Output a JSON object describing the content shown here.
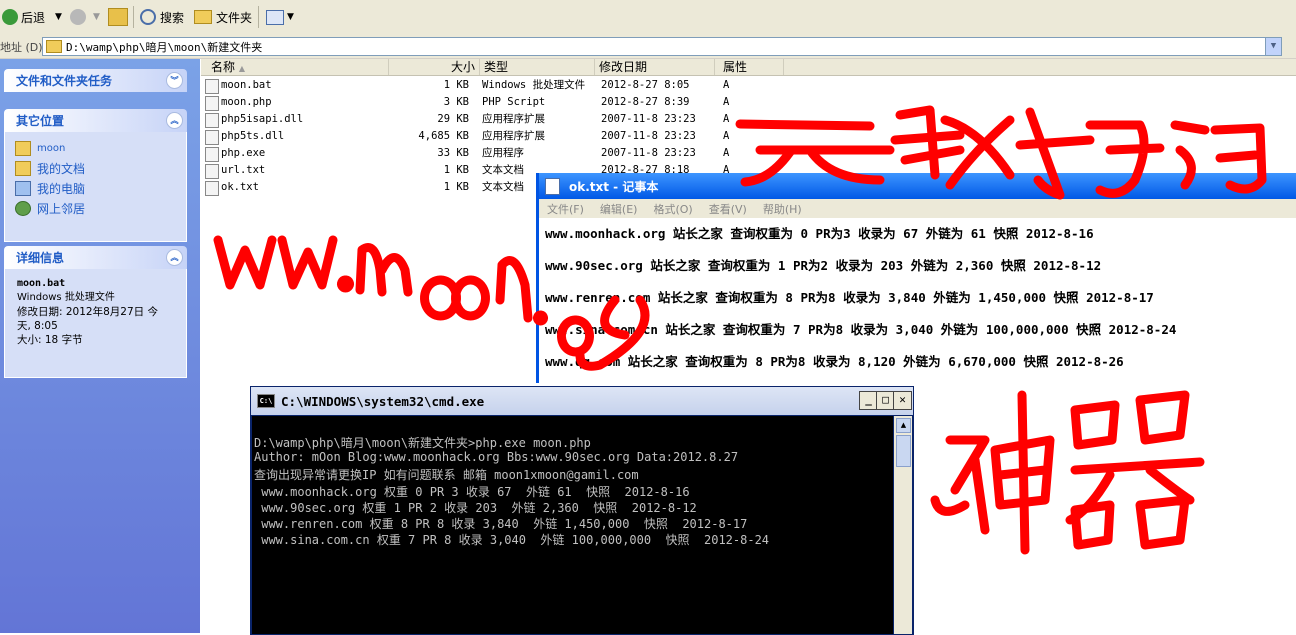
{
  "toolbar": {
    "back_label": "后退",
    "search_label": "搜索",
    "folders_label": "文件夹"
  },
  "address": {
    "label": "地址 (D)",
    "path": "D:\\wamp\\php\\暗月\\moon\\新建文件夹"
  },
  "left_pane": {
    "tasks_title": "文件和文件夹任务",
    "other_title": "其它位置",
    "other_items": [
      "moon",
      "我的文档",
      "我的电脑",
      "网上邻居"
    ],
    "details_title": "详细信息",
    "details": {
      "name": "moon.bat",
      "type": "Windows 批处理文件",
      "modified": "修改日期: 2012年8月27日 今天, 8:05",
      "size": "大小: 18 字节"
    }
  },
  "columns": {
    "name": "名称",
    "size": "大小",
    "type": "类型",
    "modified": "修改日期",
    "attr": "属性"
  },
  "files": [
    {
      "name": "moon.bat",
      "size": "1 KB",
      "type": "Windows 批处理文件",
      "modified": "2012-8-27 8:05",
      "attr": "A"
    },
    {
      "name": "moon.php",
      "size": "3 KB",
      "type": "PHP Script",
      "modified": "2012-8-27 8:39",
      "attr": "A"
    },
    {
      "name": "php5isapi.dll",
      "size": "29 KB",
      "type": "应用程序扩展",
      "modified": "2007-11-8 23:23",
      "attr": "A"
    },
    {
      "name": "php5ts.dll",
      "size": "4,685 KB",
      "type": "应用程序扩展",
      "modified": "2007-11-8 23:23",
      "attr": "A"
    },
    {
      "name": "php.exe",
      "size": "33 KB",
      "type": "应用程序",
      "modified": "2007-11-8 23:23",
      "attr": "A"
    },
    {
      "name": "url.txt",
      "size": "1 KB",
      "type": "文本文档",
      "modified": "2012-8-27 8:18",
      "attr": "A"
    },
    {
      "name": "ok.txt",
      "size": "1 KB",
      "type": "文本文档",
      "modified": "",
      "attr": ""
    }
  ],
  "notepad": {
    "title": "ok.txt - 记事本",
    "menu": [
      "文件(F)",
      "编辑(E)",
      "格式(O)",
      "查看(V)",
      "帮助(H)"
    ],
    "lines": [
      "www.moonhack.org 站长之家 查询权重为 0 PR为3 收录为 67 外链为 61 快照  2012-8-16",
      "www.90sec.org 站长之家 查询权重为 1 PR为2 收录为 203 外链为 2,360 快照  2012-8-12",
      "www.renren.com 站长之家 查询权重为 8 PR为8 收录为 3,840 外链为 1,450,000 快照  2012-8-17",
      "www.sina.com.cn 站长之家 查询权重为 7 PR为8 收录为 3,040 外链为 100,000,000 快照  2012-8-24",
      "www.qq.com 站长之家 查询权重为 8 PR为8 收录为 8,120 外链为 6,670,000 快照  2012-8-26"
    ]
  },
  "cmd": {
    "title": "C:\\WINDOWS\\system32\\cmd.exe",
    "lines": [
      "D:\\wamp\\php\\暗月\\moon\\新建文件夹>php.exe moon.php",
      "Author: mOon Blog:www.moonhack.org Bbs:www.90sec.org Data:2012.8.27",
      "查询出现异常请更换IP 如有问题联系 邮箱 moon1xmoon@gamil.com",
      " www.moonhack.org 权重 0 PR 3 收录 67  外链 61  快照  2012-8-16",
      " www.90sec.org 权重 1 PR 2 收录 203  外链 2,360  快照  2012-8-12",
      " www.renren.com 权重 8 PR 8 收录 3,840  外链 1,450,000  快照  2012-8-17",
      " www.sina.com.cn 权重 7 PR 8 收录 3,040  外链 100,000,000  快照  2012-8-24"
    ]
  },
  "colors": {
    "xp_blue": "#0058e6",
    "scribble_red": "#ff0000",
    "panel_link": "#215dc6"
  }
}
